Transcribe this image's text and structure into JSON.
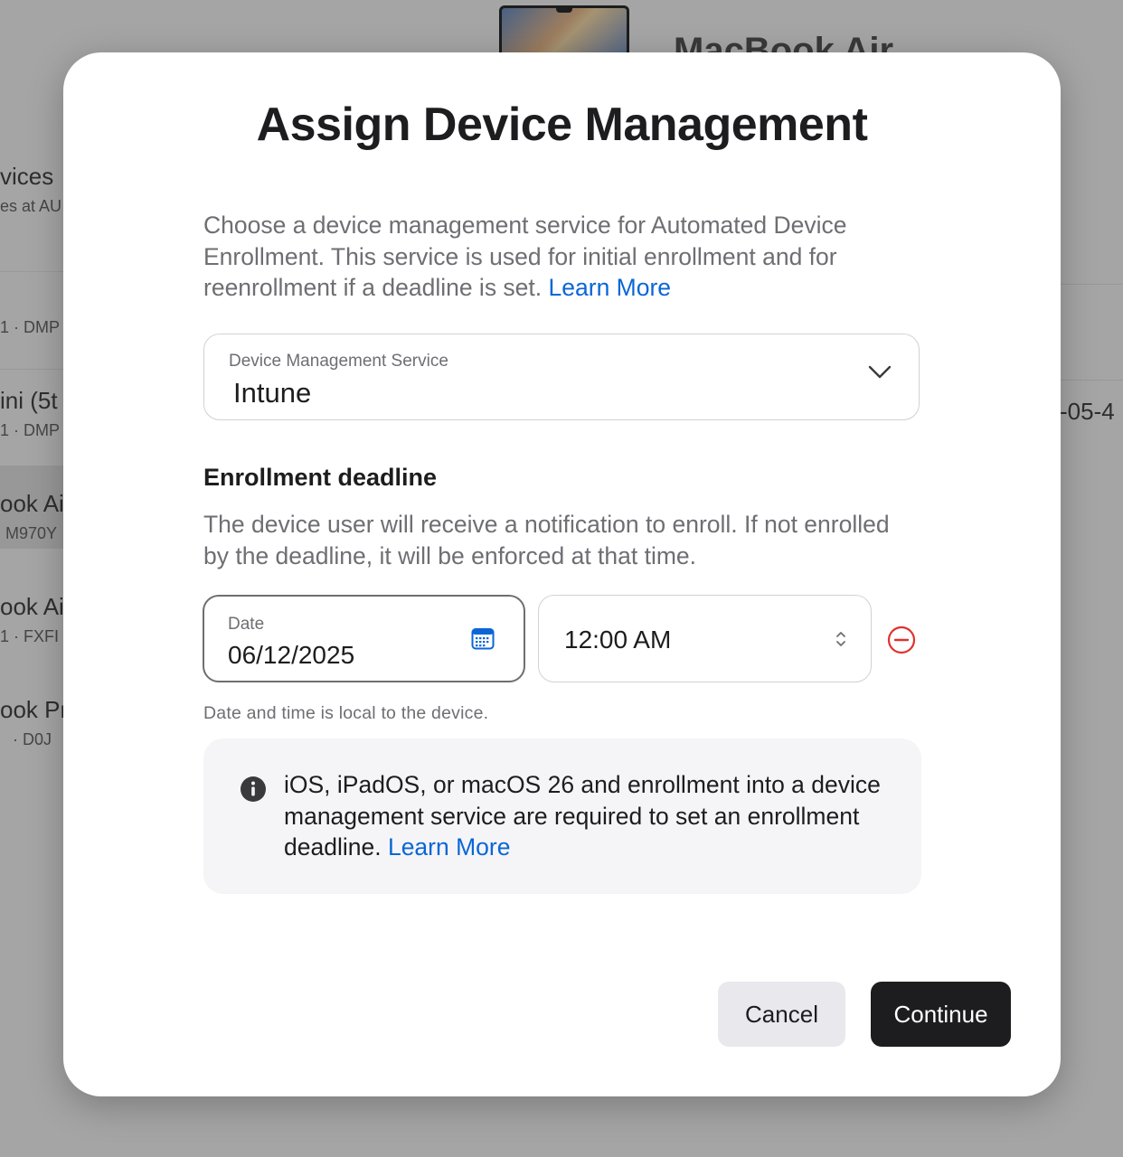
{
  "background": {
    "product_title": "MacBook Air",
    "list_items": [
      {
        "main": "vices",
        "sub": "es at AU"
      },
      {
        "main": "",
        "sub": "1 · DMP"
      },
      {
        "main": "ini (5t",
        "sub": "1 · DMP"
      },
      {
        "main": "ook Ai",
        "sub": "M970Y"
      },
      {
        "main": "ook Ai",
        "sub": "1 · FXFI"
      },
      {
        "main": "ook Pr",
        "sub": "· D0J"
      }
    ],
    "right_text": "-05-4"
  },
  "modal": {
    "title": "Assign Device Management",
    "description": "Choose a device management service for Automated Device Enrollment. This service is used for initial enrollment and for reenrollment if a deadline is set.",
    "learn_more": "Learn More",
    "service_select": {
      "label": "Device Management Service",
      "value": "Intune"
    },
    "deadline": {
      "title": "Enrollment deadline",
      "description": "The device user will receive a notification to enroll. If not enrolled by the deadline, it will be enforced at that time.",
      "date_label": "Date",
      "date_value": "06/12/2025",
      "time_value": "12:00 AM",
      "hint": "Date and time is local to the device."
    },
    "info": {
      "text": "iOS, iPadOS, or macOS 26 and enrollment into a device management service are required to set an enrollment deadline.",
      "learn_more": "Learn More"
    },
    "buttons": {
      "cancel": "Cancel",
      "continue": "Continue"
    }
  },
  "colors": {
    "link": "#0a66d6",
    "danger": "#e0322f",
    "primary_button": "#1d1d1f"
  }
}
